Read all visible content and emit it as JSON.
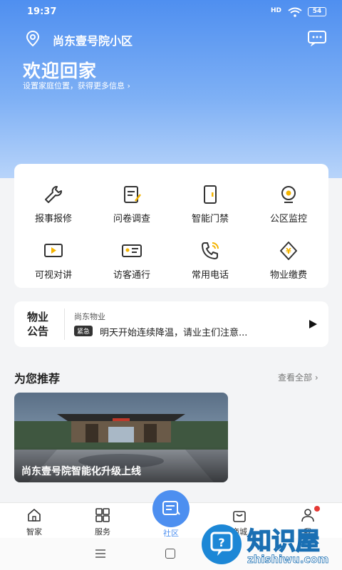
{
  "status_bar": {
    "time": "19:37",
    "signal": "HD",
    "battery": "54"
  },
  "header": {
    "community_name": "尚东壹号院小区",
    "welcome": "欢迎回家",
    "subtitle": "设置家庭位置，获得更多信息 ›"
  },
  "services": [
    {
      "label": "报事报修",
      "icon": "wrench-icon"
    },
    {
      "label": "问卷调查",
      "icon": "survey-icon"
    },
    {
      "label": "智能门禁",
      "icon": "door-icon"
    },
    {
      "label": "公区监控",
      "icon": "camera-icon"
    },
    {
      "label": "可视对讲",
      "icon": "video-icon"
    },
    {
      "label": "访客通行",
      "icon": "id-card-icon"
    },
    {
      "label": "常用电话",
      "icon": "phone-icon"
    },
    {
      "label": "物业缴费",
      "icon": "payment-icon"
    }
  ],
  "notice": {
    "title": "物业公告",
    "source": "尚东物业",
    "tag": "紧急",
    "text": "明天开始连续降温，请业主们注意..."
  },
  "recommend": {
    "title": "为您推荐",
    "view_all": "查看全部 ›",
    "card_caption": "尚东壹号院智能化升级上线"
  },
  "tabbar": {
    "tabs": [
      "智家",
      "服务",
      "社区",
      "商城",
      "我"
    ]
  },
  "watermark": {
    "brand": "知识屋",
    "domain": "zhishiwu.com"
  },
  "colors": {
    "primary": "#4d8ff0",
    "urgent_tag": "#333333",
    "badge": "#e53935"
  }
}
